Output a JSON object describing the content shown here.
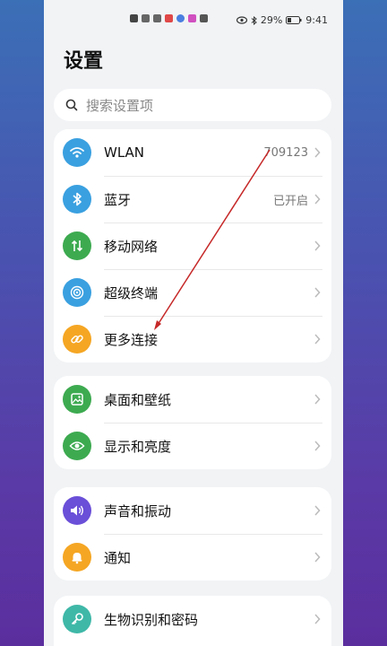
{
  "status": {
    "battery": "29%",
    "time": "9:41"
  },
  "page": {
    "title": "设置"
  },
  "search": {
    "placeholder": "搜索设置项"
  },
  "groups": [
    {
      "items": [
        {
          "label": "WLAN",
          "value": "709123",
          "icon": "wifi-icon",
          "color": "#3aa0e0"
        },
        {
          "label": "蓝牙",
          "value": "已开启",
          "icon": "bluetooth-icon",
          "color": "#3aa0e0"
        },
        {
          "label": "移动网络",
          "value": "",
          "icon": "mobile-data-icon",
          "color": "#3daa50"
        },
        {
          "label": "超级终端",
          "value": "",
          "icon": "super-device-icon",
          "color": "#3aa0e0"
        },
        {
          "label": "更多连接",
          "value": "",
          "icon": "link-icon",
          "color": "#f5a623"
        }
      ]
    },
    {
      "items": [
        {
          "label": "桌面和壁纸",
          "value": "",
          "icon": "wallpaper-icon",
          "color": "#3daa50"
        },
        {
          "label": "显示和亮度",
          "value": "",
          "icon": "eye-icon",
          "color": "#3daa50"
        }
      ]
    },
    {
      "items": [
        {
          "label": "声音和振动",
          "value": "",
          "icon": "sound-icon",
          "color": "#6a4fd8"
        },
        {
          "label": "通知",
          "value": "",
          "icon": "bell-icon",
          "color": "#f5a623"
        }
      ]
    },
    {
      "items": [
        {
          "label": "生物识别和密码",
          "value": "",
          "icon": "key-icon",
          "color": "#3fb8a8"
        }
      ]
    }
  ]
}
